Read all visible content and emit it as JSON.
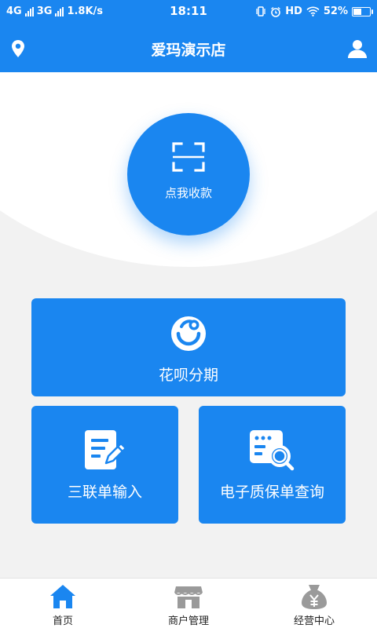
{
  "status_bar": {
    "network_1": "4G",
    "network_2": "3G",
    "speed": "1.8K/s",
    "time": "18:11",
    "hd": "HD",
    "battery_text": "52%",
    "battery_level": 0.52
  },
  "header": {
    "title": "爱玛演示店",
    "left_icon": "location-pin-icon",
    "right_icon": "user-icon"
  },
  "collect": {
    "label": "点我收款",
    "icon": "scan-icon"
  },
  "cards": {
    "huabei": {
      "label": "花呗分期",
      "icon": "huabei-icon"
    },
    "triple_form": {
      "label": "三联单输入",
      "icon": "edit-document-icon"
    },
    "warranty": {
      "label": "电子质保单查询",
      "icon": "document-search-icon"
    }
  },
  "bottom_nav": {
    "home": {
      "label": "首页",
      "icon": "home-icon",
      "active": true
    },
    "merchant": {
      "label": "商户管理",
      "icon": "store-icon",
      "active": false
    },
    "business": {
      "label": "经营中心",
      "icon": "money-bag-icon",
      "active": false
    }
  },
  "colors": {
    "primary": "#1a86f0",
    "background": "#f2f2f2",
    "inactive_icon": "#9a9a9a"
  }
}
